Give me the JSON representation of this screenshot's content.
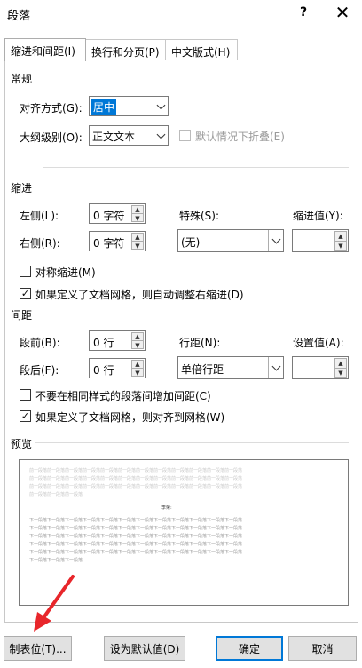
{
  "window": {
    "title": "段落",
    "help_label": "?",
    "close_label": "✕"
  },
  "tabs": [
    {
      "label": "缩进和间距(I)",
      "active": true
    },
    {
      "label": "换行和分页(P)",
      "active": false
    },
    {
      "label": "中文版式(H)",
      "active": false
    }
  ],
  "general": {
    "section_label": "常规",
    "alignment_label": "对齐方式(G):",
    "alignment_value": "居中",
    "outline_label": "大纲级别(O):",
    "outline_value": "正文文本",
    "collapse_label": "默认情况下折叠(E)"
  },
  "indent": {
    "section_label": "缩进",
    "left_label": "左侧(L):",
    "left_value": "0 字符",
    "right_label": "右侧(R):",
    "right_value": "0 字符",
    "special_label": "特殊(S):",
    "special_value": "(无)",
    "indent_by_label": "缩进值(Y):",
    "indent_by_value": "",
    "mirror_label": "对称缩进(M)",
    "mirror_checked": false,
    "auto_adjust_label": "如果定义了文档网格，则自动调整右缩进(D)",
    "auto_adjust_checked": true
  },
  "spacing": {
    "section_label": "间距",
    "before_label": "段前(B):",
    "before_value": "0 行",
    "after_label": "段后(F):",
    "after_value": "0 行",
    "line_spacing_label": "行距(N):",
    "line_spacing_value": "单倍行距",
    "at_label": "设置值(A):",
    "at_value": "",
    "no_space_label": "不要在相同样式的段落间增加间距(C)",
    "no_space_checked": false,
    "snap_grid_label": "如果定义了文档网格，则对齐到网格(W)",
    "snap_grid_checked": true
  },
  "preview": {
    "section_label": "预览",
    "prev_para_line": "前一段落前一段落前一段落前一段落前一段落前一段落前一段落前一段落前一段落前一段落前一段落前一段落",
    "prev_para_last": "前一段落前一段落前一段落",
    "sample_text": "李荣:",
    "next_para_line": "下一段落下一段落下一段落下一段落下一段落下一段落下一段落下一段落下一段落下一段落下一段落下一段落",
    "next_para_last": "下一段落下一段落下一段落"
  },
  "buttons": {
    "tabs_label": "制表位(T)...",
    "set_default_label": "设为默认值(D)",
    "ok_label": "确定",
    "cancel_label": "取消"
  },
  "colors": {
    "accent": "#0078d7",
    "annotation_arrow": "#e8262b"
  },
  "icons": {
    "close": "close-icon",
    "help": "help-icon",
    "dropdown": "chevron-down-icon",
    "spinner": "spinner-arrows-icon"
  }
}
